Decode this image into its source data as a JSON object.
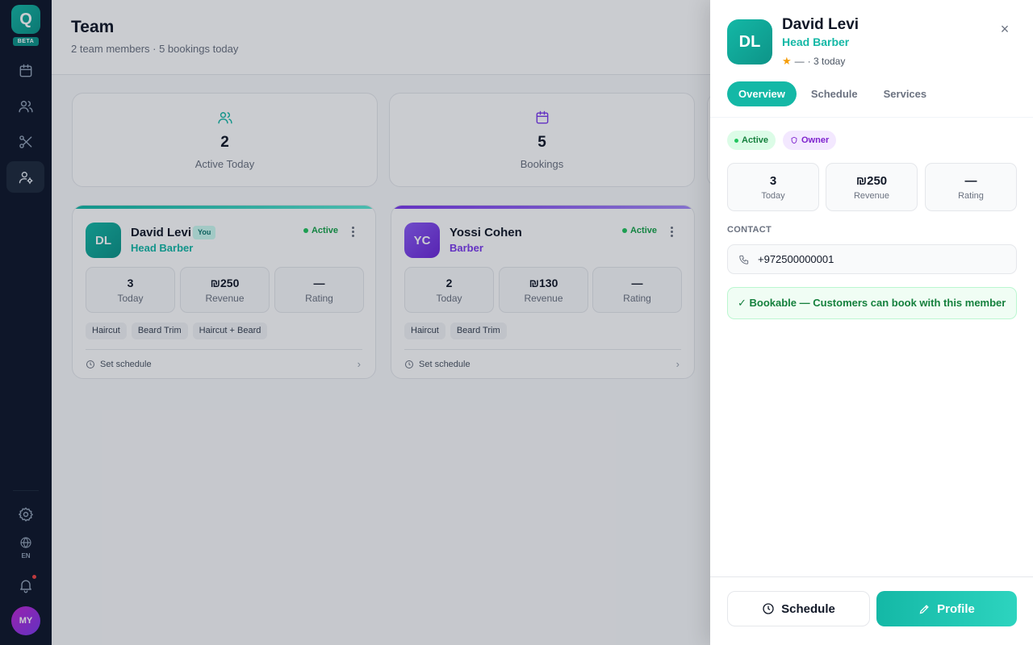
{
  "app": {
    "logo_letter": "Q",
    "beta_label": "BETA",
    "lang": "EN",
    "user_initials": "MY"
  },
  "colors": {
    "accent": "#14b8a6",
    "purple": "#7c3aed",
    "sidebar": "#0f172a",
    "active_green": "#16a34a"
  },
  "header": {
    "title": "Team",
    "subtitle": "2 team members · 5 bookings today"
  },
  "stats": [
    {
      "value": "2",
      "label": "Active Today",
      "icon": "users-icon"
    },
    {
      "value": "5",
      "label": "Bookings",
      "icon": "calendar-icon"
    }
  ],
  "members": [
    {
      "initials": "DL",
      "name": "David Levi",
      "badge": "You",
      "role": "Head Barber",
      "status": "Active",
      "stats": [
        {
          "value": "3",
          "label": "Today"
        },
        {
          "value": "₪250",
          "label": "Revenue"
        },
        {
          "value": "—",
          "label": "Rating"
        }
      ],
      "services": [
        "Haircut",
        "Beard Trim",
        "Haircut + Beard"
      ],
      "footer": "Set schedule"
    },
    {
      "initials": "YC",
      "name": "Yossi Cohen",
      "role": "Barber",
      "status": "Active",
      "stats": [
        {
          "value": "2",
          "label": "Today"
        },
        {
          "value": "₪130",
          "label": "Revenue"
        },
        {
          "value": "—",
          "label": "Rating"
        }
      ],
      "services": [
        "Haircut",
        "Beard Trim"
      ],
      "footer": "Set schedule"
    }
  ],
  "drawer": {
    "initials": "DL",
    "name": "David Levi",
    "role": "Head Barber",
    "rating": "—",
    "today_count": "· 3 today",
    "tabs": [
      "Overview",
      "Schedule",
      "Services"
    ],
    "status_pill": "Active",
    "owner_pill": "Owner",
    "stats": [
      {
        "value": "3",
        "label": "Today"
      },
      {
        "value": "₪250",
        "label": "Revenue"
      },
      {
        "value": "—",
        "label": "Rating"
      }
    ],
    "contact_label": "CONTACT",
    "phone": "+972500000001",
    "bookable": "✓ Bookable — Customers can book with this member",
    "schedule_button": "Schedule",
    "profile_button": "Profile"
  }
}
